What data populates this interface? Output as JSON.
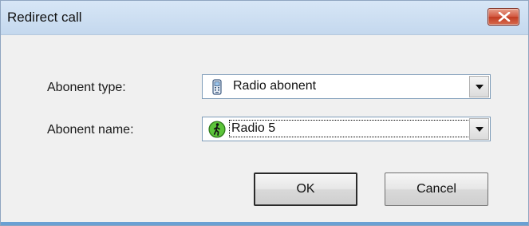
{
  "window": {
    "title": "Redirect call",
    "close_icon": "close-icon",
    "close_color": "#c23c22"
  },
  "form": {
    "abonent_type": {
      "label": "Abonent type:",
      "value": "Radio abonent",
      "icon": "radio-handset-icon"
    },
    "abonent_name": {
      "label": "Abonent name:",
      "value": "Radio 5",
      "icon": "walking-person-green-icon"
    }
  },
  "buttons": {
    "ok_label": "OK",
    "cancel_label": "Cancel"
  }
}
